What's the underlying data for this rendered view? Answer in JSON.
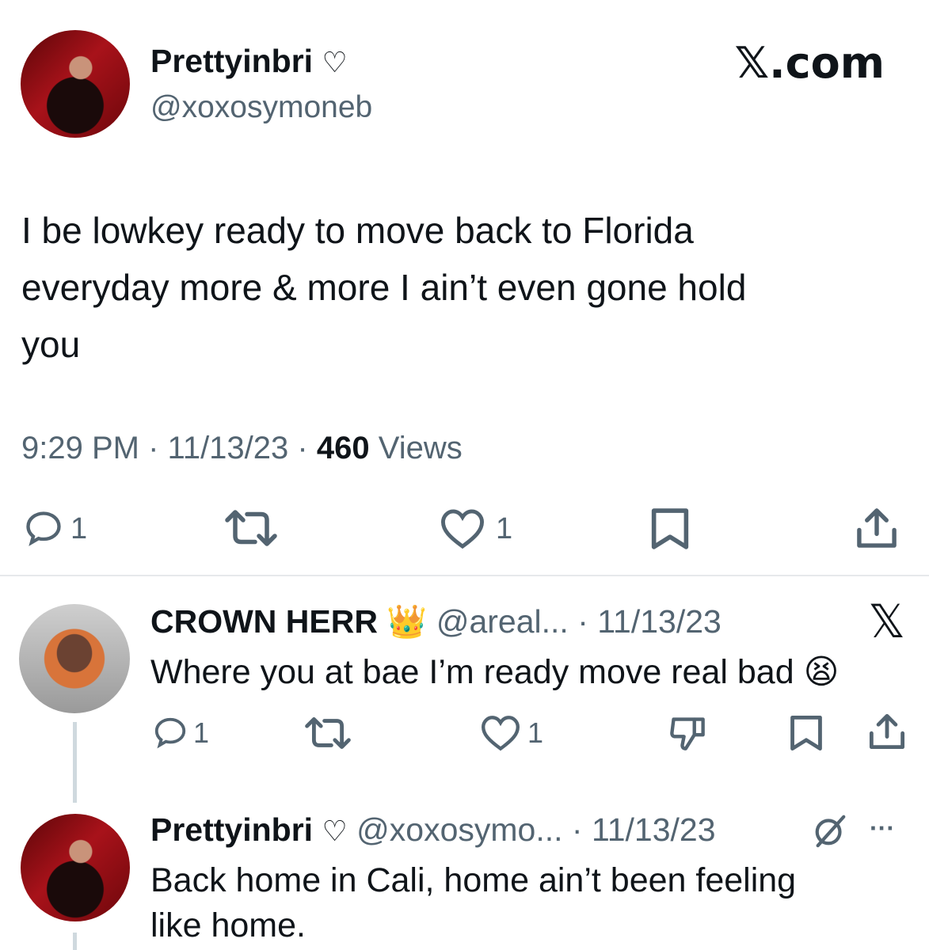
{
  "main_tweet": {
    "display_name": "Prettyinbri",
    "name_symbol": "♡",
    "handle": "@xoxosymoneb",
    "brand": "𝕏.com",
    "text_lines": [
      "I be lowkey ready to move back to Florida",
      "everyday more & more I ain’t even gone hold",
      "you"
    ],
    "time": "9:29 PM",
    "sep1": "·",
    "date": "11/13/23",
    "sep2": "·",
    "views_count": "460",
    "views_label": "Views",
    "actions": {
      "reply_count": "1",
      "like_count": "1"
    }
  },
  "reply_1": {
    "display_name": "CROWN HERR",
    "emoji": "👑",
    "handle": "@areal...",
    "sep": "·",
    "date": "11/13/23",
    "brand": "𝕏",
    "text": "Where you at bae I’m ready move real bad",
    "text_emoji": "😫",
    "actions": {
      "reply_count": "1",
      "like_count": "1"
    }
  },
  "reply_2": {
    "display_name": "Prettyinbri",
    "name_symbol": "♡",
    "handle": "@xoxosymo...",
    "sep": "·",
    "date": "11/13/23",
    "more": "···",
    "text_lines": [
      "Back home in Cali, home ain’t been feeling",
      "like home."
    ]
  },
  "colors": {
    "text": "#0f1419",
    "muted": "#536471",
    "divider": "#e6e9eb",
    "thread_line": "#cfd9de"
  }
}
